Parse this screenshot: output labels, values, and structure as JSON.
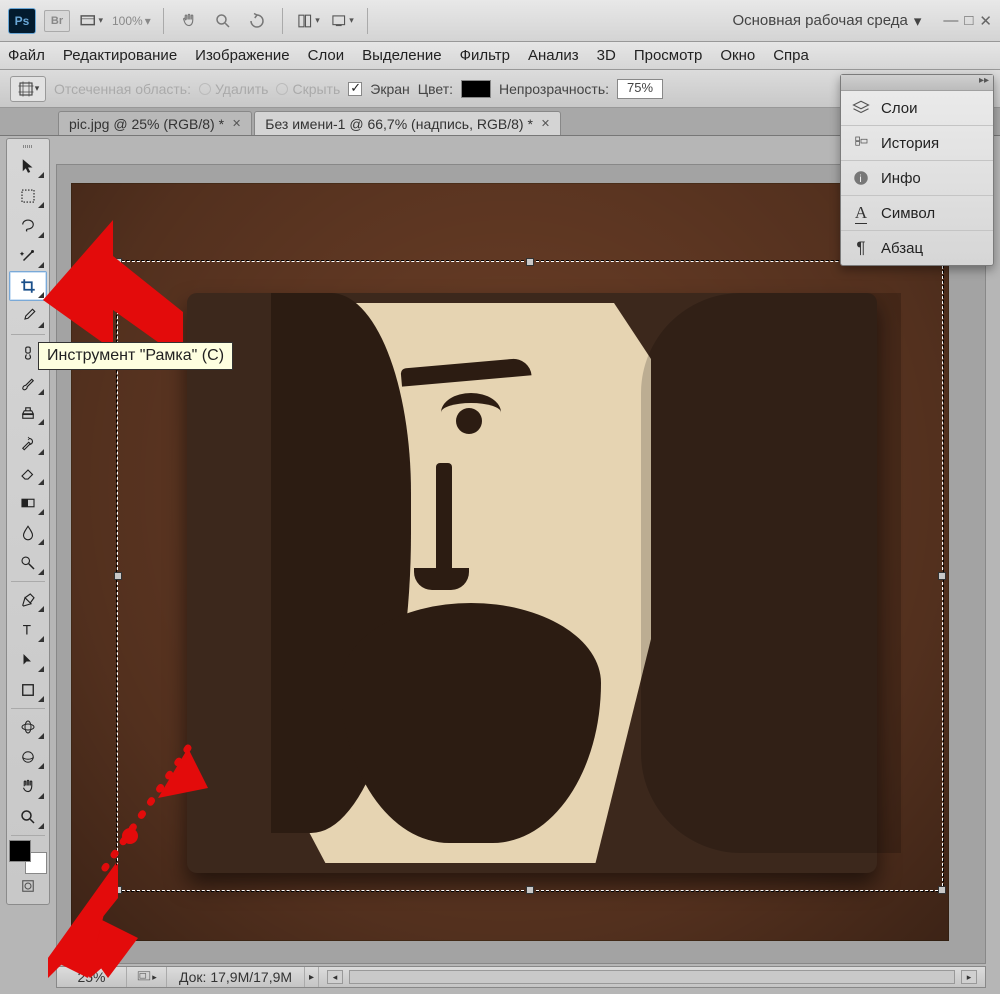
{
  "appbar": {
    "zoom_readout": "100%",
    "workspace_label": "Основная рабочая среда"
  },
  "menu": {
    "file": "Файл",
    "edit": "Редактирование",
    "image": "Изображение",
    "layer": "Слои",
    "select": "Выделение",
    "filter": "Фильтр",
    "analysis": "Анализ",
    "threeD": "3D",
    "view": "Просмотр",
    "window": "Окно",
    "help": "Спра"
  },
  "options": {
    "cropped_area": "Отсеченная область:",
    "delete": "Удалить",
    "hide": "Скрыть",
    "screen": "Экран",
    "color": "Цвет:",
    "opacity_label": "Непрозрачность:",
    "opacity_value": "75%"
  },
  "tabs": {
    "t1": "pic.jpg @ 25% (RGB/8) *",
    "t2": "Без имени-1 @ 66,7% (надпись, RGB/8) *"
  },
  "tooltip": "Инструмент \"Рамка\" (C)",
  "right_panel": {
    "items": [
      {
        "label": "Слои",
        "icon": "layers"
      },
      {
        "label": "История",
        "icon": "history"
      },
      {
        "label": "Инфо",
        "icon": "info"
      },
      {
        "label": "Символ",
        "icon": "character"
      },
      {
        "label": "Абзац",
        "icon": "paragraph"
      }
    ]
  },
  "status": {
    "zoom": "25%",
    "docinfo": "Док: 17,9M/17,9M"
  }
}
